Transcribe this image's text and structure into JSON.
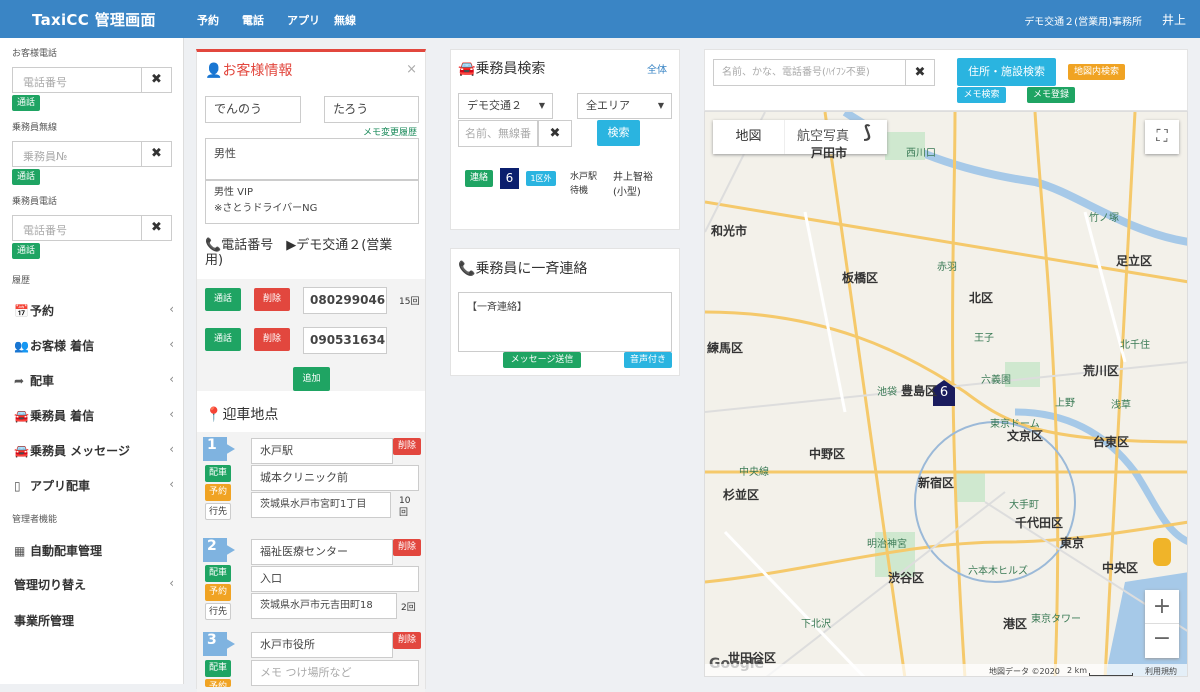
{
  "header": {
    "brand": "TaxiCC 管理画面",
    "nav": [
      "予約",
      "電話",
      "アプリ",
      "無線"
    ],
    "office": "デモ交通２(営業用)事務所",
    "user": "井上"
  },
  "sidebar": {
    "customer_phone_label": "お客様電話",
    "customer_phone_placeholder": "電話番号",
    "driver_radio_label": "乗務員無線",
    "driver_radio_placeholder": "乗務員№",
    "driver_phone_label": "乗務員電話",
    "driver_phone_placeholder": "電話番号",
    "call_label": "通話",
    "clear_label": "✖",
    "history_label": "履歴",
    "menu": [
      {
        "icon": "📅",
        "label": "予約"
      },
      {
        "icon": "👥",
        "label": "お客様 着信"
      },
      {
        "icon": "➦",
        "label": "配車"
      },
      {
        "icon": "🚘",
        "label": "乗務員 着信"
      },
      {
        "icon": "🚘",
        "label": "乗務員 メッセージ"
      },
      {
        "icon": "▯",
        "label": "アプリ配車"
      }
    ],
    "admin_label": "管理者機能",
    "admin_menu": [
      {
        "icon": "▦",
        "label": "自動配車管理"
      },
      {
        "icon": "",
        "label": "管理切り替え"
      },
      {
        "icon": "",
        "label": "事業所管理"
      }
    ]
  },
  "customer": {
    "title": "お客様情報",
    "close": "×",
    "last_name": "でんのう",
    "first_name": "たろう",
    "memo_history": "メモ変更履歴",
    "gender": "男性",
    "notes": [
      "男性 VIP",
      "※さとうドライバーNG"
    ],
    "phone_heading": "電話番号",
    "company_heading": "デモ交通２(営業",
    "company_heading2": "用)",
    "phones": [
      {
        "call": "通話",
        "delete": "削除",
        "number": "080299046",
        "count": "15回"
      },
      {
        "call": "通話",
        "delete": "削除",
        "number": "090531634",
        "count": ""
      }
    ],
    "add": "追加",
    "pickup_heading": "迎車地点",
    "pickups": [
      {
        "num": "1",
        "name": "水戸駅",
        "delete": "削除",
        "memo": "城本クリニック前",
        "addr": "茨城県水戸市宮町1丁目",
        "count": "10回",
        "b1": "配車",
        "b2": "予約",
        "b3": "行先"
      },
      {
        "num": "2",
        "name": "福祉医療センター",
        "delete": "削除",
        "memo": "入口",
        "addr": "茨城県水戸市元吉田町18",
        "count": "2回",
        "b1": "配車",
        "b2": "予約",
        "b3": "行先"
      },
      {
        "num": "3",
        "name": "水戸市役所",
        "delete": "削除",
        "memo": "メモ つけ場所など",
        "b1": "配車",
        "b2": "予約"
      }
    ]
  },
  "driver_search": {
    "title": "乗務員検索",
    "all": "全体",
    "company": "デモ交通２",
    "area": "全エリア",
    "name_placeholder": "名前、無線番",
    "search": "検索",
    "result": {
      "status": "連絡",
      "num": "6",
      "zone": "1区外",
      "loc": "水戸駅",
      "loc2": "待機",
      "name": "井上智裕",
      "car": "(小型)"
    }
  },
  "broadcast": {
    "title": "乗務員に一斉連絡",
    "text": "【一斉連絡】",
    "send": "メッセージ送信",
    "voice": "音声付き"
  },
  "map_search": {
    "placeholder": "名前、かな、電話番号(ﾊｲﾌﾝ不要)",
    "addr_search": "住所・施設検索",
    "map_search": "地図内検索",
    "memo_search": "メモ検索",
    "memo_register": "メモ登録"
  },
  "map": {
    "tab_map": "地図",
    "tab_aerial": "航空写真",
    "marker": "6",
    "google": "Google",
    "copyright": "地図データ ©2020",
    "scale": "2 km",
    "terms": "利用規約",
    "wards": [
      {
        "t": "戸田市",
        "l": 810,
        "tp": 151
      },
      {
        "t": "和光市",
        "l": 710,
        "tp": 229
      },
      {
        "t": "板橋区",
        "l": 841,
        "tp": 276
      },
      {
        "t": "北区",
        "l": 968,
        "tp": 296
      },
      {
        "t": "足立区",
        "l": 1115,
        "tp": 259
      },
      {
        "t": "練馬区",
        "l": 706,
        "tp": 346
      },
      {
        "t": "荒川区",
        "l": 1082,
        "tp": 369
      },
      {
        "t": "豊島区",
        "l": 900,
        "tp": 389
      },
      {
        "t": "文京区",
        "l": 1006,
        "tp": 434
      },
      {
        "t": "台東区",
        "l": 1092,
        "tp": 440
      },
      {
        "t": "中野区",
        "l": 808,
        "tp": 452
      },
      {
        "t": "杉並区",
        "l": 722,
        "tp": 493
      },
      {
        "t": "新宿区",
        "l": 917,
        "tp": 481
      },
      {
        "t": "千代田区",
        "l": 1014,
        "tp": 521
      },
      {
        "t": "東京",
        "l": 1059,
        "tp": 541
      },
      {
        "t": "中央区",
        "l": 1101,
        "tp": 566
      },
      {
        "t": "渋谷区",
        "l": 887,
        "tp": 576
      },
      {
        "t": "港区",
        "l": 1002,
        "tp": 622
      },
      {
        "t": "世田谷区",
        "l": 727,
        "tp": 656
      }
    ],
    "spots": [
      {
        "t": "西川口",
        "l": 905,
        "tp": 149
      },
      {
        "t": "竹ノ塚",
        "l": 1088,
        "tp": 214
      },
      {
        "t": "赤羽",
        "l": 936,
        "tp": 263
      },
      {
        "t": "王子",
        "l": 973,
        "tp": 334
      },
      {
        "t": "北千住",
        "l": 1119,
        "tp": 341
      },
      {
        "t": "池袋",
        "l": 876,
        "tp": 388
      },
      {
        "t": "上野",
        "l": 1054,
        "tp": 399
      },
      {
        "t": "六義園",
        "l": 980,
        "tp": 376
      },
      {
        "t": "東京ドーム",
        "l": 989,
        "tp": 420
      },
      {
        "t": "東京タワー",
        "l": 1030,
        "tp": 615
      },
      {
        "t": "浅草",
        "l": 1110,
        "tp": 401
      },
      {
        "t": "明治神宮",
        "l": 866,
        "tp": 540
      },
      {
        "t": "六本木ヒルズ",
        "l": 967,
        "tp": 567
      },
      {
        "t": "下北沢",
        "l": 800,
        "tp": 620
      },
      {
        "t": "大手町",
        "l": 1008,
        "tp": 501
      },
      {
        "t": "中央線",
        "l": 738,
        "tp": 468
      }
    ]
  }
}
